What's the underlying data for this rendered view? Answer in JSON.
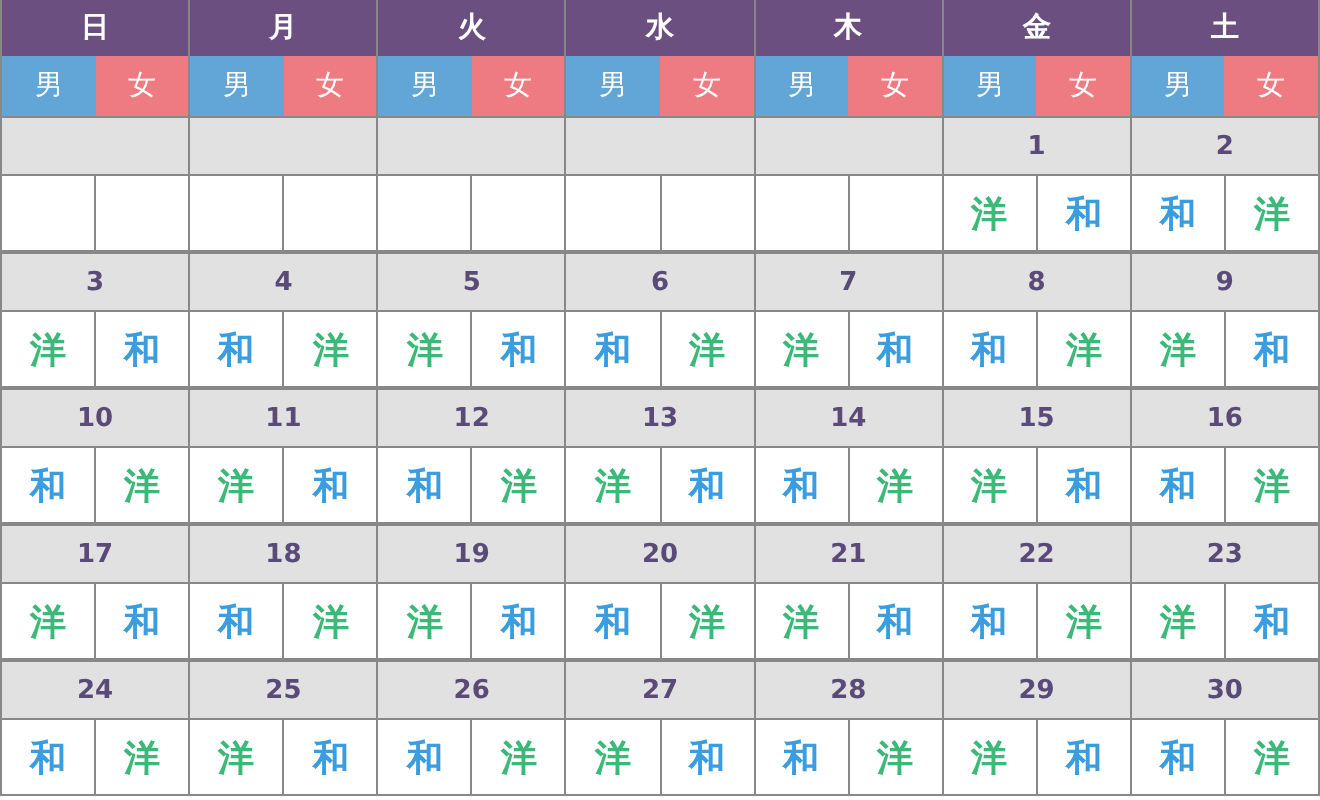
{
  "weekdays": [
    {
      "label": "日",
      "sexes": [
        {
          "label": "男",
          "color": "#62a5d7"
        },
        {
          "label": "女",
          "color": "#ef7b82"
        }
      ]
    },
    {
      "label": "月",
      "sexes": [
        {
          "label": "男",
          "color": "#62a5d7"
        },
        {
          "label": "女",
          "color": "#ef7b82"
        }
      ]
    },
    {
      "label": "火",
      "sexes": [
        {
          "label": "男",
          "color": "#62a5d7"
        },
        {
          "label": "女",
          "color": "#ef7b82"
        }
      ]
    },
    {
      "label": "水",
      "sexes": [
        {
          "label": "男",
          "color": "#62a5d7"
        },
        {
          "label": "女",
          "color": "#ef7b82"
        }
      ]
    },
    {
      "label": "木",
      "sexes": [
        {
          "label": "男",
          "color": "#62a5d7"
        },
        {
          "label": "女",
          "color": "#ef7b82"
        }
      ]
    },
    {
      "label": "金",
      "sexes": [
        {
          "label": "男",
          "color": "#62a5d7"
        },
        {
          "label": "女",
          "color": "#ef7b82"
        }
      ]
    },
    {
      "label": "土",
      "sexes": [
        {
          "label": "男",
          "color": "#62a5d7"
        },
        {
          "label": "女",
          "color": "#ef7b82"
        }
      ]
    }
  ],
  "weeks": [
    [
      {
        "kind": "blank"
      },
      {
        "kind": "blank"
      },
      {
        "kind": "blank"
      },
      {
        "kind": "blank"
      },
      {
        "kind": "blank"
      },
      {
        "kind": "day",
        "date": "1",
        "meals": [
          {
            "label": "洋",
            "color": "#3cb878"
          },
          {
            "label": "和",
            "color": "#3a9de0"
          }
        ]
      },
      {
        "kind": "day",
        "date": "2",
        "meals": [
          {
            "label": "和",
            "color": "#3a9de0"
          },
          {
            "label": "洋",
            "color": "#3cb878"
          }
        ]
      }
    ],
    [
      {
        "kind": "day",
        "date": "3",
        "meals": [
          {
            "label": "洋",
            "color": "#3cb878"
          },
          {
            "label": "和",
            "color": "#3a9de0"
          }
        ]
      },
      {
        "kind": "day",
        "date": "4",
        "meals": [
          {
            "label": "和",
            "color": "#3a9de0"
          },
          {
            "label": "洋",
            "color": "#3cb878"
          }
        ]
      },
      {
        "kind": "day",
        "date": "5",
        "meals": [
          {
            "label": "洋",
            "color": "#3cb878"
          },
          {
            "label": "和",
            "color": "#3a9de0"
          }
        ]
      },
      {
        "kind": "day",
        "date": "6",
        "meals": [
          {
            "label": "和",
            "color": "#3a9de0"
          },
          {
            "label": "洋",
            "color": "#3cb878"
          }
        ]
      },
      {
        "kind": "day",
        "date": "7",
        "meals": [
          {
            "label": "洋",
            "color": "#3cb878"
          },
          {
            "label": "和",
            "color": "#3a9de0"
          }
        ]
      },
      {
        "kind": "day",
        "date": "8",
        "meals": [
          {
            "label": "和",
            "color": "#3a9de0"
          },
          {
            "label": "洋",
            "color": "#3cb878"
          }
        ]
      },
      {
        "kind": "day",
        "date": "9",
        "meals": [
          {
            "label": "洋",
            "color": "#3cb878"
          },
          {
            "label": "和",
            "color": "#3a9de0"
          }
        ]
      }
    ],
    [
      {
        "kind": "day",
        "date": "10",
        "meals": [
          {
            "label": "和",
            "color": "#3a9de0"
          },
          {
            "label": "洋",
            "color": "#3cb878"
          }
        ]
      },
      {
        "kind": "day",
        "date": "11",
        "meals": [
          {
            "label": "洋",
            "color": "#3cb878"
          },
          {
            "label": "和",
            "color": "#3a9de0"
          }
        ]
      },
      {
        "kind": "day",
        "date": "12",
        "meals": [
          {
            "label": "和",
            "color": "#3a9de0"
          },
          {
            "label": "洋",
            "color": "#3cb878"
          }
        ]
      },
      {
        "kind": "day",
        "date": "13",
        "meals": [
          {
            "label": "洋",
            "color": "#3cb878"
          },
          {
            "label": "和",
            "color": "#3a9de0"
          }
        ]
      },
      {
        "kind": "day",
        "date": "14",
        "meals": [
          {
            "label": "和",
            "color": "#3a9de0"
          },
          {
            "label": "洋",
            "color": "#3cb878"
          }
        ]
      },
      {
        "kind": "day",
        "date": "15",
        "meals": [
          {
            "label": "洋",
            "color": "#3cb878"
          },
          {
            "label": "和",
            "color": "#3a9de0"
          }
        ]
      },
      {
        "kind": "day",
        "date": "16",
        "meals": [
          {
            "label": "和",
            "color": "#3a9de0"
          },
          {
            "label": "洋",
            "color": "#3cb878"
          }
        ]
      }
    ],
    [
      {
        "kind": "day",
        "date": "17",
        "meals": [
          {
            "label": "洋",
            "color": "#3cb878"
          },
          {
            "label": "和",
            "color": "#3a9de0"
          }
        ]
      },
      {
        "kind": "day",
        "date": "18",
        "meals": [
          {
            "label": "和",
            "color": "#3a9de0"
          },
          {
            "label": "洋",
            "color": "#3cb878"
          }
        ]
      },
      {
        "kind": "day",
        "date": "19",
        "meals": [
          {
            "label": "洋",
            "color": "#3cb878"
          },
          {
            "label": "和",
            "color": "#3a9de0"
          }
        ]
      },
      {
        "kind": "day",
        "date": "20",
        "meals": [
          {
            "label": "和",
            "color": "#3a9de0"
          },
          {
            "label": "洋",
            "color": "#3cb878"
          }
        ]
      },
      {
        "kind": "day",
        "date": "21",
        "meals": [
          {
            "label": "洋",
            "color": "#3cb878"
          },
          {
            "label": "和",
            "color": "#3a9de0"
          }
        ]
      },
      {
        "kind": "day",
        "date": "22",
        "meals": [
          {
            "label": "和",
            "color": "#3a9de0"
          },
          {
            "label": "洋",
            "color": "#3cb878"
          }
        ]
      },
      {
        "kind": "day",
        "date": "23",
        "meals": [
          {
            "label": "洋",
            "color": "#3cb878"
          },
          {
            "label": "和",
            "color": "#3a9de0"
          }
        ]
      }
    ],
    [
      {
        "kind": "day",
        "date": "24",
        "meals": [
          {
            "label": "和",
            "color": "#3a9de0"
          },
          {
            "label": "洋",
            "color": "#3cb878"
          }
        ]
      },
      {
        "kind": "day",
        "date": "25",
        "meals": [
          {
            "label": "洋",
            "color": "#3cb878"
          },
          {
            "label": "和",
            "color": "#3a9de0"
          }
        ]
      },
      {
        "kind": "day",
        "date": "26",
        "meals": [
          {
            "label": "和",
            "color": "#3a9de0"
          },
          {
            "label": "洋",
            "color": "#3cb878"
          }
        ]
      },
      {
        "kind": "day",
        "date": "27",
        "meals": [
          {
            "label": "洋",
            "color": "#3cb878"
          },
          {
            "label": "和",
            "color": "#3a9de0"
          }
        ]
      },
      {
        "kind": "day",
        "date": "28",
        "meals": [
          {
            "label": "和",
            "color": "#3a9de0"
          },
          {
            "label": "洋",
            "color": "#3cb878"
          }
        ]
      },
      {
        "kind": "day",
        "date": "29",
        "meals": [
          {
            "label": "洋",
            "color": "#3cb878"
          },
          {
            "label": "和",
            "color": "#3a9de0"
          }
        ]
      },
      {
        "kind": "day",
        "date": "30",
        "meals": [
          {
            "label": "和",
            "color": "#3a9de0"
          },
          {
            "label": "洋",
            "color": "#3cb878"
          }
        ]
      }
    ]
  ]
}
